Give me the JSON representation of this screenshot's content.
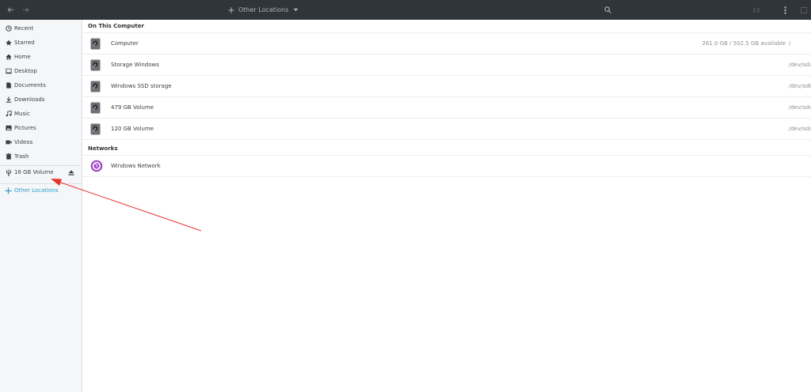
{
  "header": {
    "location_label": "Other Locations",
    "icons": [
      "back-arrow-icon",
      "forward-arrow-icon",
      "plus-icon",
      "chevron-down-icon",
      "search-icon",
      "view-options-icon",
      "kebab-menu-icon"
    ]
  },
  "sidebar": {
    "items": [
      {
        "label": "Recent",
        "icon": "clock-icon"
      },
      {
        "label": "Starred",
        "icon": "star-icon"
      },
      {
        "label": "Home",
        "icon": "home-icon"
      },
      {
        "label": "Desktop",
        "icon": "desktop-icon"
      },
      {
        "label": "Documents",
        "icon": "document-icon"
      },
      {
        "label": "Downloads",
        "icon": "download-icon"
      },
      {
        "label": "Music",
        "icon": "music-icon"
      },
      {
        "label": "Pictures",
        "icon": "pictures-icon"
      },
      {
        "label": "Videos",
        "icon": "video-icon"
      },
      {
        "label": "Trash",
        "icon": "trash-icon"
      }
    ],
    "volume": {
      "label": "16 GB Volume",
      "icon": "usb-icon",
      "eject_icon": "eject-icon"
    },
    "other_locations": {
      "label": "Other Locations",
      "icon": "plus-icon",
      "color": "#2d9ccf"
    }
  },
  "main": {
    "on_this_computer": {
      "title": "On This Computer",
      "rows": [
        {
          "label": "Computer",
          "info": "261.0 GB / 502.5 GB available",
          "device": "/"
        },
        {
          "label": "Storage Windows",
          "info": "",
          "device": "/dev/sda"
        },
        {
          "label": "Windows SSD storage",
          "info": "",
          "device": "/dev/sdb"
        },
        {
          "label": "479 GB Volume",
          "info": "",
          "device": "/dev/sdc"
        },
        {
          "label": "120 GB Volume",
          "info": "",
          "device": "/dev/sdd"
        }
      ]
    },
    "networks": {
      "title": "Networks",
      "rows": [
        {
          "label": "Windows Network",
          "icon": "network-icon"
        }
      ]
    }
  },
  "colors": {
    "headerbar": "#2f3539",
    "sidebar": "#f5f6f7",
    "accent": "#2d9ccf",
    "annotation_arrow": "#e8322d",
    "network_icon": "#9c3fc1"
  }
}
